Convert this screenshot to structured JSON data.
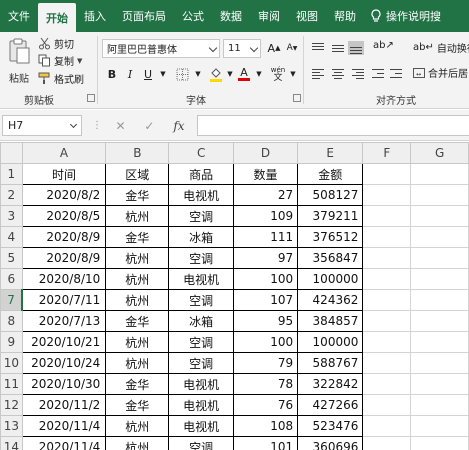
{
  "tabs": [
    "文件",
    "开始",
    "插入",
    "页面布局",
    "公式",
    "数据",
    "审阅",
    "视图",
    "帮助"
  ],
  "active_tab": "开始",
  "help_search": {
    "icon": "lightbulb-icon",
    "label": "操作说明搜"
  },
  "clipboard": {
    "paste_label": "粘贴",
    "cut_label": "剪切",
    "copy_label": "复制",
    "painter_label": "格式刷",
    "group_label": "剪贴板"
  },
  "font": {
    "font_name": "阿里巴巴普惠体",
    "font_size": "11",
    "grow_label": "A",
    "shrink_label": "A",
    "bold": "B",
    "italic": "I",
    "underline": "U",
    "wen_label": "wén",
    "group_label": "字体"
  },
  "alignment": {
    "wrap_label": "自动换行",
    "merge_label": "合并后居",
    "group_label": "对齐方式"
  },
  "formula_bar": {
    "cell_ref": "H7",
    "fx": "fx",
    "content": ""
  },
  "colors": {
    "brand": "#217346"
  },
  "sheet": {
    "columns": [
      "A",
      "B",
      "C",
      "D",
      "E",
      "F",
      "G"
    ],
    "rows": [
      "1",
      "2",
      "3",
      "4",
      "5",
      "6",
      "7",
      "8",
      "9",
      "10",
      "11",
      "12",
      "13",
      "14"
    ],
    "active_row": "7",
    "header": [
      "时间",
      "区域",
      "商品",
      "数量",
      "金额"
    ],
    "data": [
      [
        "2020/8/2",
        "金华",
        "电视机",
        "27",
        "508127"
      ],
      [
        "2020/8/5",
        "杭州",
        "空调",
        "109",
        "379211"
      ],
      [
        "2020/8/9",
        "金华",
        "冰箱",
        "111",
        "376512"
      ],
      [
        "2020/8/9",
        "杭州",
        "空调",
        "97",
        "356847"
      ],
      [
        "2020/8/10",
        "杭州",
        "电视机",
        "100",
        "100000"
      ],
      [
        "2020/7/11",
        "杭州",
        "空调",
        "107",
        "424362"
      ],
      [
        "2020/7/13",
        "金华",
        "冰箱",
        "95",
        "384857"
      ],
      [
        "2020/10/21",
        "杭州",
        "空调",
        "100",
        "100000"
      ],
      [
        "2020/10/24",
        "杭州",
        "空调",
        "79",
        "588767"
      ],
      [
        "2020/10/30",
        "金华",
        "电视机",
        "78",
        "322842"
      ],
      [
        "2020/11/2",
        "金华",
        "电视机",
        "76",
        "427266"
      ],
      [
        "2020/11/4",
        "杭州",
        "电视机",
        "108",
        "523476"
      ],
      [
        "2020/11/4",
        "杭州",
        "空调",
        "101",
        "360696"
      ]
    ]
  }
}
